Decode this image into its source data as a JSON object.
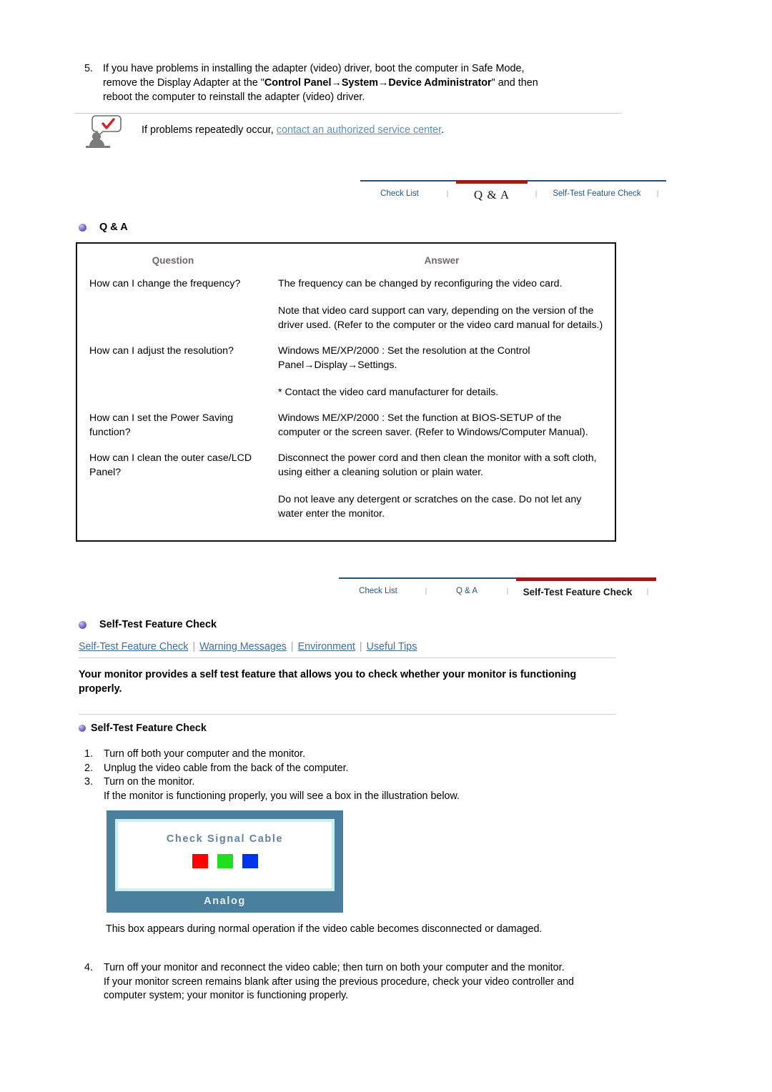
{
  "step5": {
    "number": "5.",
    "line1": "If you have problems in installing the adapter (video) driver, boot the computer in Safe Mode,",
    "line2_pre": "remove the Display Adapter at the \"",
    "line2_bold": "Control Panel→System→Device Administrator",
    "line2_post": "\" and then",
    "line3": "reboot the computer to reinstall the adapter (video) driver."
  },
  "note": {
    "icon": "person-speech-bubble-check-icon",
    "text_pre": "If problems repeatedly occur, ",
    "link": "contact an authorized service center",
    "text_post": "."
  },
  "tabnav_1": {
    "tabs": [
      {
        "label": "Check List",
        "state": "inactive"
      },
      {
        "label": "Q & A",
        "state": "active"
      },
      {
        "label": "Self-Test Feature Check",
        "state": "inactive"
      }
    ],
    "separator": "|",
    "active_color": "#9c1b18",
    "inactive_color": "#24507e",
    "link_color": "#1f5585"
  },
  "tabnav_2": {
    "tabs": [
      {
        "label": "Check List",
        "state": "inactive"
      },
      {
        "label": "Q & A",
        "state": "inactive"
      },
      {
        "label": "Self-Test Feature Check",
        "state": "active"
      }
    ],
    "separator": "|",
    "active_color": "#9c1b18",
    "inactive_color": "#24507e",
    "link_color": "#1f5585"
  },
  "qa_section": {
    "heading": "Q & A",
    "bullet": "purple-orb-bullet-icon",
    "columns": {
      "question": "Question",
      "answer": "Answer"
    },
    "rows": [
      {
        "question": "How can I change the frequency?",
        "answers": [
          "The frequency can be changed by reconfiguring the video card.",
          "Note that video card support can vary, depending on the version of the driver used. (Refer to the computer or the video card manual for details.)"
        ]
      },
      {
        "question": "How can I adjust the resolution?",
        "answers": [
          "Windows ME/XP/2000 : Set the resolution at the Control Panel→Display→Settings.",
          "* Contact the video card manufacturer for details."
        ]
      },
      {
        "question": "How can I set the Power Saving function?",
        "answers": [
          "Windows ME/XP/2000 : Set the function at BIOS-SETUP of the computer or the screen saver. (Refer to Windows/Computer Manual)."
        ]
      },
      {
        "question": "How can I clean the outer case/LCD Panel?",
        "answers": [
          "Disconnect the power cord and then clean the monitor with a soft cloth, using either a cleaning solution or plain water.",
          "Do not leave any detergent or scratches on the case. Do not let any water enter the monitor."
        ]
      }
    ]
  },
  "stfc_section": {
    "heading": "Self-Test Feature Check",
    "bullet": "purple-orb-bullet-icon",
    "sublinks": [
      "Self-Test Feature Check",
      "Warning Messages",
      "Environment",
      "Useful Tips"
    ],
    "divider": "|",
    "lead": "Your monitor provides a self test feature that allows you to check whether your monitor is functioning properly.",
    "subheading": "Self-Test Feature Check",
    "steps": [
      {
        "number": "1.",
        "text": "Turn off both your computer and the monitor."
      },
      {
        "number": "2.",
        "text": "Unplug the video cable from the back of the computer."
      },
      {
        "number": "3.",
        "text": "Turn on the monitor.",
        "extra": "If the monitor is functioning properly, you will see a box in the illustration below."
      }
    ],
    "illustration": {
      "message": "Check Signal Cable",
      "label": "Analog",
      "frame_color": "#4a7f9e",
      "inner_border_color": "#c6f2f0",
      "screen_color": "#ffffff",
      "message_color": "#5d84a4",
      "swatches": [
        {
          "name": "red-swatch",
          "color": "#ff0000"
        },
        {
          "name": "green-swatch",
          "color": "#22dd22"
        },
        {
          "name": "blue-swatch",
          "color": "#0033ee"
        }
      ]
    },
    "after_illustration": "This box appears during normal operation if the video cable becomes disconnected or damaged.",
    "step4": {
      "number": "4.",
      "text": "Turn off your monitor and reconnect the video cable; then turn on both your computer and the monitor.",
      "extra": "If your monitor screen remains blank after using the previous procedure, check your video controller and computer system; your monitor is functioning properly."
    }
  }
}
